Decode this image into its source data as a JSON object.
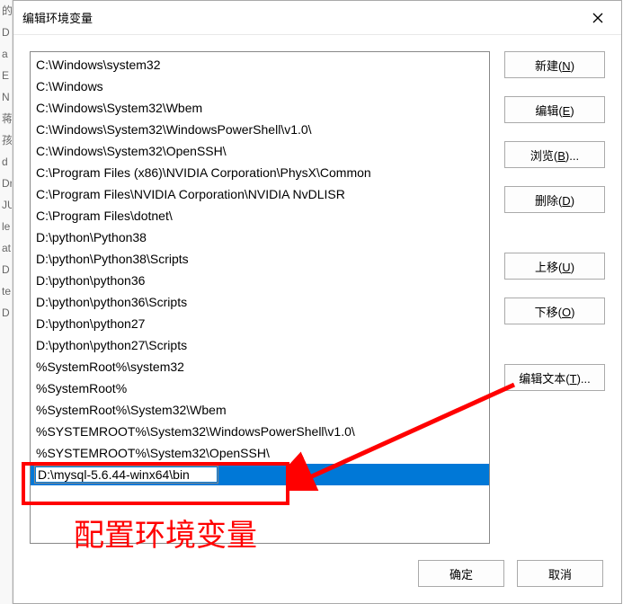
{
  "edge_letters": [
    "",
    "的",
    "",
    "D",
    "a",
    "E",
    "N",
    "",
    "",
    "",
    "",
    "",
    "",
    "",
    "蒋",
    "",
    "孩",
    "",
    "d",
    "Dr",
    "JU",
    "le",
    "at",
    "D",
    "te",
    "D"
  ],
  "dialog": {
    "title": "编辑环境变量",
    "close_tooltip": "关闭"
  },
  "paths": [
    "C:\\Windows\\system32",
    "C:\\Windows",
    "C:\\Windows\\System32\\Wbem",
    "C:\\Windows\\System32\\WindowsPowerShell\\v1.0\\",
    "C:\\Windows\\System32\\OpenSSH\\",
    "C:\\Program Files (x86)\\NVIDIA Corporation\\PhysX\\Common",
    "C:\\Program Files\\NVIDIA Corporation\\NVIDIA NvDLISR",
    "C:\\Program Files\\dotnet\\",
    "D:\\python\\Python38",
    "D:\\python\\Python38\\Scripts",
    "D:\\python\\python36",
    "D:\\python\\python36\\Scripts",
    "D:\\python\\python27",
    "D:\\python\\python27\\Scripts",
    "%SystemRoot%\\system32",
    "%SystemRoot%",
    "%SystemRoot%\\System32\\Wbem",
    "%SYSTEMROOT%\\System32\\WindowsPowerShell\\v1.0\\",
    "%SYSTEMROOT%\\System32\\OpenSSH\\"
  ],
  "selected_value": "D:\\mysql-5.6.44-winx64\\bin",
  "buttons": {
    "new": {
      "label": "新建(",
      "hotkey": "N",
      "suffix": ")"
    },
    "edit": {
      "label": "编辑(",
      "hotkey": "E",
      "suffix": ")"
    },
    "browse": {
      "label": "浏览(",
      "hotkey": "B",
      "suffix": ")..."
    },
    "delete": {
      "label": "删除(",
      "hotkey": "D",
      "suffix": ")"
    },
    "up": {
      "label": "上移(",
      "hotkey": "U",
      "suffix": ")"
    },
    "down": {
      "label": "下移(",
      "hotkey": "O",
      "suffix": ")"
    },
    "edit_text": {
      "label": "编辑文本(",
      "hotkey": "T",
      "suffix": ")..."
    },
    "ok": {
      "label": "确定"
    },
    "cancel": {
      "label": "取消"
    }
  },
  "annotation": {
    "text": "配置环境变量"
  }
}
